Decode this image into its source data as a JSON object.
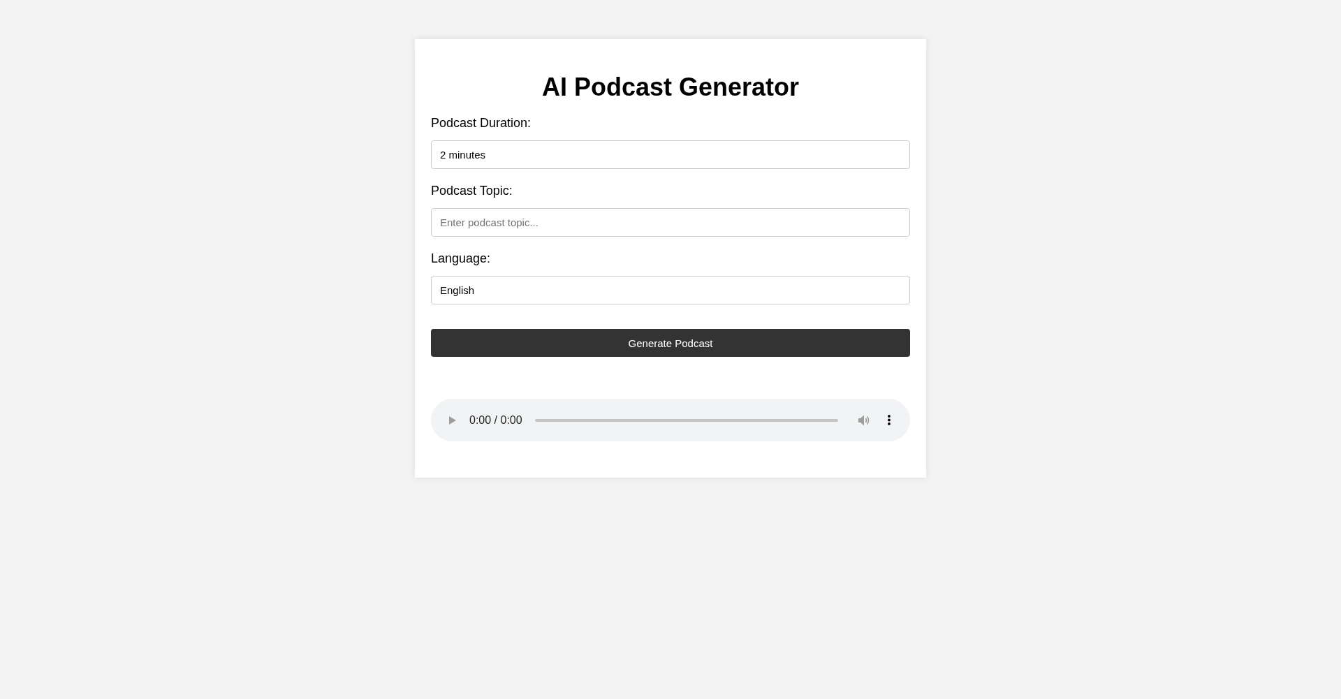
{
  "title": "AI Podcast Generator",
  "fields": [
    {
      "label": "Podcast Duration:",
      "value": "2 minutes"
    },
    {
      "label": "Podcast Topic:",
      "placeholder": "Enter podcast topic..."
    },
    {
      "label": "Language:",
      "value": "English"
    }
  ],
  "generate_button": {
    "label": "Generate Podcast"
  },
  "audio_player": {
    "time": "0:00 / 0:00",
    "disabled": true
  }
}
